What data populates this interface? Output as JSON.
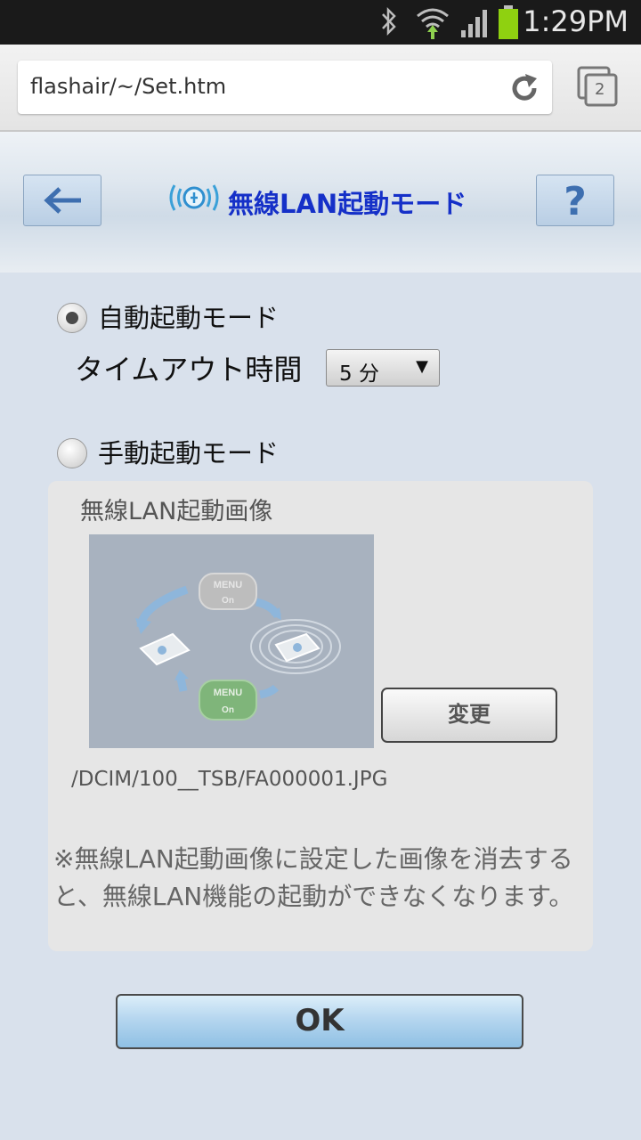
{
  "status_bar": {
    "time": "1:29PM",
    "icons": [
      "bluetooth-icon",
      "wifi-icon",
      "signal-icon",
      "battery-icon"
    ]
  },
  "browser": {
    "url": "flashair/~/Set.htm",
    "tab_count": "2"
  },
  "header": {
    "title": "無線LAN起動モード",
    "help_label": "?"
  },
  "form": {
    "auto_mode_label": "自動起動モード",
    "timeout_label": "タイムアウト時間",
    "timeout_value": "5 分",
    "manual_mode_label": "手動起動モード",
    "selected_mode": "auto"
  },
  "panel": {
    "title": "無線LAN起動画像",
    "change_button": "変更",
    "image_path": "/DCIM/100__TSB/FA000001.JPG",
    "note": "※無線LAN起動画像に設定した画像を消去すると、無線LAN機能の起動ができなくなります。",
    "preview_labels": [
      "MENU",
      "On",
      "MENU",
      "On"
    ]
  },
  "ok_button": "OK",
  "colors": {
    "title": "#1530c8",
    "background": "#d9e1ec",
    "ok_button": "#a8cde9"
  }
}
